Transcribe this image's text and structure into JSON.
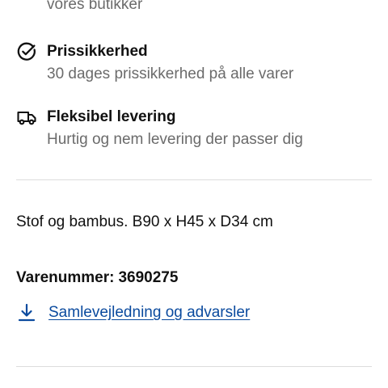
{
  "stores_text": "vores butikker",
  "usps": [
    {
      "icon": "check-circle-icon",
      "title": "Prissikkerhed",
      "description": "30 dages prissikkerhed på alle varer"
    },
    {
      "icon": "delivery-truck-icon",
      "title": "Fleksibel levering",
      "description": "Hurtig og nem levering der passer dig"
    }
  ],
  "product": {
    "description": "Stof og bambus. B90 x H45 x D34 cm",
    "article_number_label": "Varenummer:",
    "article_number": "3690275"
  },
  "download": {
    "icon": "download-icon",
    "label": "Samlevejledning og advarsler"
  },
  "colors": {
    "text": "#111111",
    "muted_text": "#6b6b6b",
    "link": "#0a4a9e",
    "divider": "#dcdcdc"
  }
}
